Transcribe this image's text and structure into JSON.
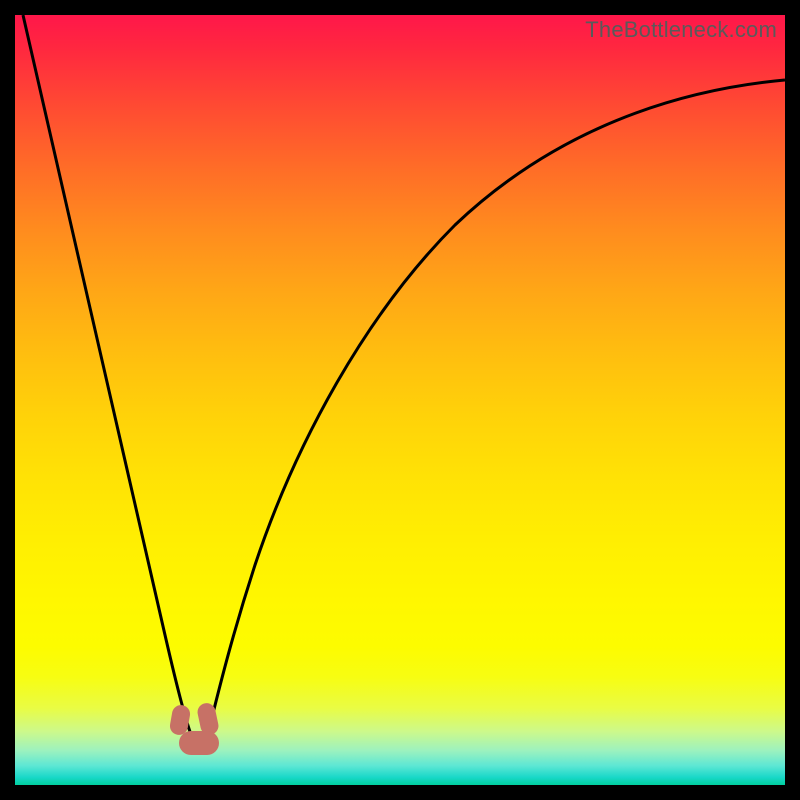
{
  "watermark": "TheBottleneck.com",
  "colors": {
    "frame": "#000000",
    "curve": "#000000",
    "marker": "#c77166"
  },
  "chart_data": {
    "type": "line",
    "title": "",
    "xlabel": "",
    "ylabel": "",
    "xlim": [
      0,
      100
    ],
    "ylim": [
      0,
      100
    ],
    "grid": false,
    "series": [
      {
        "name": "left-branch",
        "x": [
          1,
          4,
          7,
          10,
          13,
          16,
          19,
          21,
          22.5,
          23.5
        ],
        "y": [
          100,
          83,
          66,
          50,
          35,
          22,
          12,
          6,
          3,
          2
        ]
      },
      {
        "name": "right-branch",
        "x": [
          24.5,
          26,
          28,
          31,
          35,
          40,
          46,
          53,
          61,
          70,
          80,
          90,
          100
        ],
        "y": [
          2,
          4,
          9,
          18,
          30,
          42,
          53,
          63,
          71,
          77,
          82,
          86,
          88
        ]
      }
    ],
    "markers": [
      {
        "x": 21.5,
        "y": 7
      },
      {
        "x": 25,
        "y": 7
      },
      {
        "x": 23.5,
        "y": 3
      }
    ],
    "gradient_stops": [
      {
        "pos": 0.0,
        "color": "#ff174a"
      },
      {
        "pos": 0.5,
        "color": "#ffd209"
      },
      {
        "pos": 0.82,
        "color": "#fdfc00"
      },
      {
        "pos": 1.0,
        "color": "#00cf9f"
      }
    ]
  }
}
